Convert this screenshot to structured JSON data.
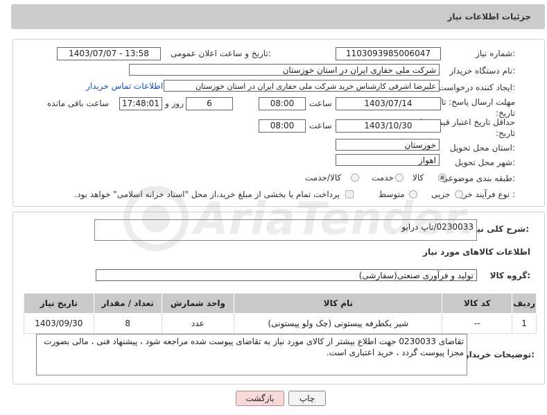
{
  "header": {
    "title": "جزئیات اطلاعات نیاز"
  },
  "form": {
    "need_number_label": "شماره نیاز:",
    "need_number": "1103093985006047",
    "announce_label": "تاریخ و ساعت اعلان عمومی:",
    "announce_value": "1403/07/07 - 13:58",
    "buyer_org_label": "نام دستگاه خریدار:",
    "buyer_org": "شرکت ملی حفاری ایران در استان خوزستان",
    "creator_label": "ایجاد کننده درخواست:",
    "creator": "علیرضا اشرفی کارشناس خرید شرکت ملی حفاری ایران در استان خوزستان",
    "contact_link": "اطلاعات تماس خریدار",
    "reply_deadline_label": "مهلت ارسال پاسخ: تا تاریخ:",
    "reply_date": "1403/07/14",
    "time_label": "ساعت",
    "reply_time": "08:00",
    "days_value": "6",
    "days_label": "روز و",
    "remaining_time": "17:48:01",
    "remaining_label": "ساعت باقی مانده",
    "price_validity_label": "حداقل تاریخ اعتبار قیمت: تا تاریخ:",
    "price_date": "1403/10/30",
    "price_time": "08:00",
    "province_label": "استان محل تحویل:",
    "province": "خوزستان",
    "city_label": "شهر محل تحویل:",
    "city": "اهواز",
    "category_label": "طبقه بندی موضوعی:",
    "category_options": [
      "کالا",
      "خدمت",
      "کالا/خدمت"
    ],
    "process_label": "نوع فرآیند خرید :",
    "process_options": [
      "جزیی",
      "متوسط"
    ],
    "payment_note": "پرداخت تمام یا بخشی از مبلغ خرید،از محل \"اسناد خزانه اسلامی\" خواهد بود."
  },
  "details": {
    "summary_label": "شرح کلی نیاز:",
    "summary": "0230033/تاپ درایو",
    "goods_info_title": "اطلاعات کالاهای مورد نیاز",
    "goods_group_label": "گروه کالا:",
    "goods_group": "تولید و فرآوری صنعتی(سفارشی)"
  },
  "table": {
    "headers": [
      "ردیف",
      "کد کالا",
      "نام کالا",
      "واحد شمارش",
      "تعداد / مقدار",
      "تاریخ نیاز"
    ],
    "rows": [
      [
        "1",
        "--",
        "شیر یکطرفه پیستونی (چک ولو پیستونی)",
        "عدد",
        "8",
        "1403/09/30"
      ]
    ]
  },
  "buyer_notes": {
    "label": "توضیحات خریدار:",
    "text": "تقاضای 0230033 جهت اطلاع بیشتر از کالای مورد نیاز به تقاضای پیوست شده مراجعه شود ، پیشنهاد فنی ، مالی بصورت مجزا پیوست گردد ، خرید اعتباری است."
  },
  "buttons": {
    "print": "چاپ",
    "back": "بازگشت"
  },
  "watermark_text": "AriaTender.neT",
  "colors": {
    "title_bar": "#c9cbcc",
    "link": "#1a4fb4",
    "back_button_bg": "#f6dada",
    "table_header": "#c9c9c9"
  }
}
